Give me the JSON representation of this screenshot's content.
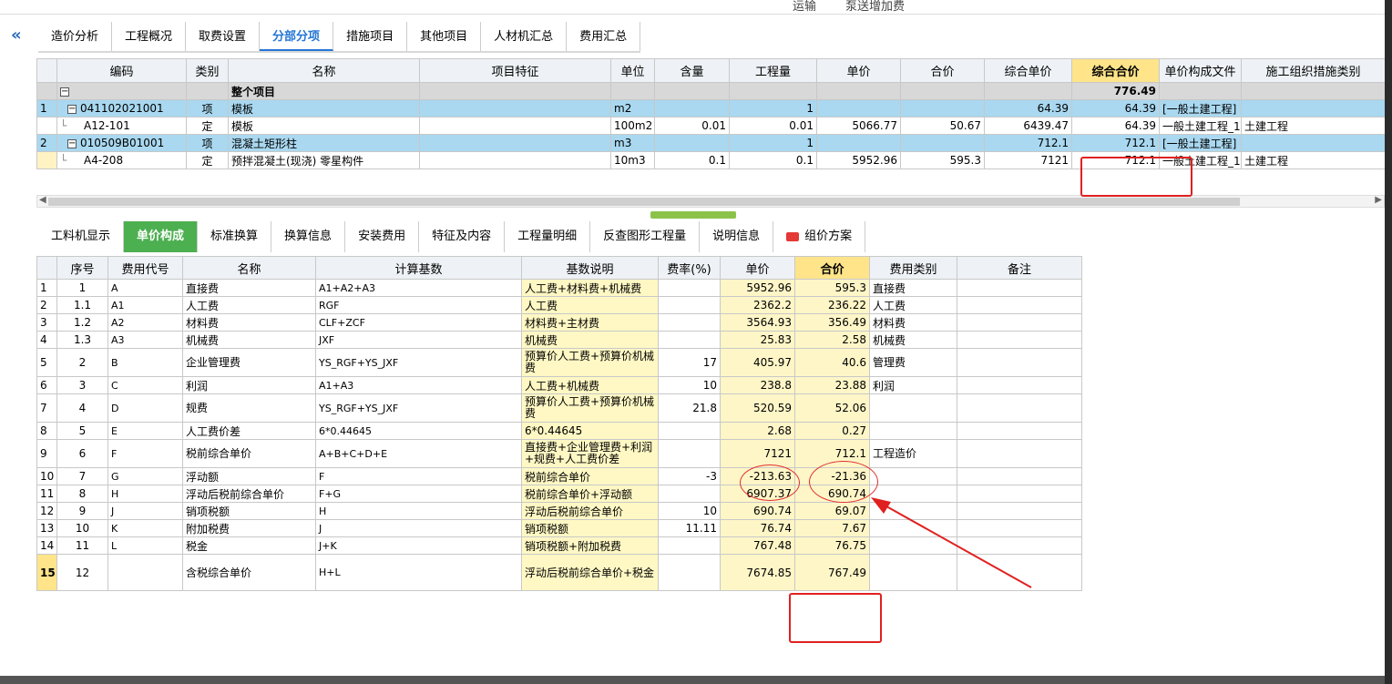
{
  "top_strip": {
    "item1": "运输",
    "item2": "泵送增加费"
  },
  "nav_tabs": [
    "造价分析",
    "工程概况",
    "取费设置",
    "分部分项",
    "措施项目",
    "其他项目",
    "人材机汇总",
    "费用汇总"
  ],
  "items_table": {
    "headers": [
      "",
      "编码",
      "类别",
      "名称",
      "项目特征",
      "单位",
      "含量",
      "工程量",
      "单价",
      "合价",
      "综合单价",
      "综合合价",
      "单价构成文件",
      "施工组织措施类别"
    ],
    "rows": [
      {
        "idx": "",
        "code": "",
        "type": "",
        "name": "整个项目",
        "feature": "",
        "unit": "",
        "content": "",
        "qty": "",
        "price": "",
        "total": "",
        "unit_price": "",
        "combined_total": "776.49",
        "file": "",
        "category": ""
      },
      {
        "idx": "1",
        "code": "041102021001",
        "type": "项",
        "name": "模板",
        "feature": "",
        "unit": "m2",
        "content": "",
        "qty": "1",
        "price": "",
        "total": "",
        "unit_price": "64.39",
        "combined_total": "64.39",
        "file": "[一般土建工程]",
        "category": ""
      },
      {
        "idx": "",
        "code": "A12-101",
        "type": "定",
        "name": "模板",
        "feature": "",
        "unit": "100m2",
        "content": "0.01",
        "qty": "0.01",
        "price": "5066.77",
        "total": "50.67",
        "unit_price": "6439.47",
        "combined_total": "64.39",
        "file": "一般土建工程_1",
        "category": "土建工程"
      },
      {
        "idx": "2",
        "code": "010509B01001",
        "type": "项",
        "name": "混凝土矩形柱",
        "feature": "",
        "unit": "m3",
        "content": "",
        "qty": "1",
        "price": "",
        "total": "",
        "unit_price": "712.1",
        "combined_total": "712.1",
        "file": "[一般土建工程]",
        "category": ""
      },
      {
        "idx": "",
        "code": "A4-208",
        "type": "定",
        "name": "预拌混凝土(现浇) 零星构件",
        "feature": "",
        "unit": "10m3",
        "content": "0.1",
        "qty": "0.1",
        "price": "5952.96",
        "total": "595.3",
        "unit_price": "7121",
        "combined_total": "712.1",
        "file": "一般土建工程_1",
        "category": "土建工程"
      }
    ]
  },
  "detail_tabs": [
    "工料机显示",
    "单价构成",
    "标准换算",
    "换算信息",
    "安装费用",
    "特征及内容",
    "工程量明细",
    "反查图形工程量",
    "说明信息",
    "组价方案"
  ],
  "cost_table": {
    "headers": [
      "",
      "序号",
      "费用代号",
      "名称",
      "计算基数",
      "基数说明",
      "费率(%)",
      "单价",
      "合价",
      "费用类别",
      "备注"
    ],
    "rows": [
      {
        "n": "1",
        "seq": "1",
        "code": "A",
        "name": "直接费",
        "base": "A1+A2+A3",
        "desc": "人工费+材料费+机械费",
        "rate": "",
        "price": "5952.96",
        "total": "595.3",
        "cat": "直接费",
        "note": ""
      },
      {
        "n": "2",
        "seq": "1.1",
        "code": "A1",
        "name": "人工费",
        "base": "RGF",
        "desc": "人工费",
        "rate": "",
        "price": "2362.2",
        "total": "236.22",
        "cat": "人工费",
        "note": ""
      },
      {
        "n": "3",
        "seq": "1.2",
        "code": "A2",
        "name": "材料费",
        "base": "CLF+ZCF",
        "desc": "材料费+主材费",
        "rate": "",
        "price": "3564.93",
        "total": "356.49",
        "cat": "材料费",
        "note": ""
      },
      {
        "n": "4",
        "seq": "1.3",
        "code": "A3",
        "name": "机械费",
        "base": "JXF",
        "desc": "机械费",
        "rate": "",
        "price": "25.83",
        "total": "2.58",
        "cat": "机械费",
        "note": ""
      },
      {
        "n": "5",
        "seq": "2",
        "code": "B",
        "name": "企业管理费",
        "base": "YS_RGF+YS_JXF",
        "desc": "预算价人工费+预算价机械费",
        "rate": "17",
        "price": "405.97",
        "total": "40.6",
        "cat": "管理费",
        "note": ""
      },
      {
        "n": "6",
        "seq": "3",
        "code": "C",
        "name": "利润",
        "base": "A1+A3",
        "desc": "人工费+机械费",
        "rate": "10",
        "price": "238.8",
        "total": "23.88",
        "cat": "利润",
        "note": ""
      },
      {
        "n": "7",
        "seq": "4",
        "code": "D",
        "name": "规费",
        "base": "YS_RGF+YS_JXF",
        "desc": "预算价人工费+预算价机械费",
        "rate": "21.8",
        "price": "520.59",
        "total": "52.06",
        "cat": "",
        "note": ""
      },
      {
        "n": "8",
        "seq": "5",
        "code": "E",
        "name": "人工费价差",
        "base": "6*0.44645",
        "desc": "6*0.44645",
        "rate": "",
        "price": "2.68",
        "total": "0.27",
        "cat": "",
        "note": ""
      },
      {
        "n": "9",
        "seq": "6",
        "code": "F",
        "name": "税前综合单价",
        "base": "A+B+C+D+E",
        "desc": "直接费+企业管理费+利润+规费+人工费价差",
        "rate": "",
        "price": "7121",
        "total": "712.1",
        "cat": "工程造价",
        "note": ""
      },
      {
        "n": "10",
        "seq": "7",
        "code": "G",
        "name": "浮动额",
        "base": "F",
        "desc": "税前综合单价",
        "rate": "-3",
        "price": "-213.63",
        "total": "-21.36",
        "cat": "",
        "note": ""
      },
      {
        "n": "11",
        "seq": "8",
        "code": "H",
        "name": "浮动后税前综合单价",
        "base": "F+G",
        "desc": "税前综合单价+浮动额",
        "rate": "",
        "price": "6907.37",
        "total": "690.74",
        "cat": "",
        "note": ""
      },
      {
        "n": "12",
        "seq": "9",
        "code": "J",
        "name": "销项税额",
        "base": "H",
        "desc": "浮动后税前综合单价",
        "rate": "10",
        "price": "690.74",
        "total": "69.07",
        "cat": "",
        "note": ""
      },
      {
        "n": "13",
        "seq": "10",
        "code": "K",
        "name": "附加税费",
        "base": "J",
        "desc": "销项税额",
        "rate": "11.11",
        "price": "76.74",
        "total": "7.67",
        "cat": "",
        "note": ""
      },
      {
        "n": "14",
        "seq": "11",
        "code": "L",
        "name": "税金",
        "base": "J+K",
        "desc": "销项税额+附加税费",
        "rate": "",
        "price": "767.48",
        "total": "76.75",
        "cat": "",
        "note": ""
      },
      {
        "n": "15",
        "seq": "12",
        "code": "",
        "name": "含税综合单价",
        "base": "H+L",
        "desc": "浮动后税前综合单价+税金",
        "rate": "",
        "price": "7674.85",
        "total": "767.49",
        "cat": "",
        "note": ""
      }
    ]
  },
  "colors": {
    "accent": "#2476d6",
    "active_tab_green": "#4caf50",
    "highlight": "#ffe48a",
    "annotation": "#e02020"
  }
}
